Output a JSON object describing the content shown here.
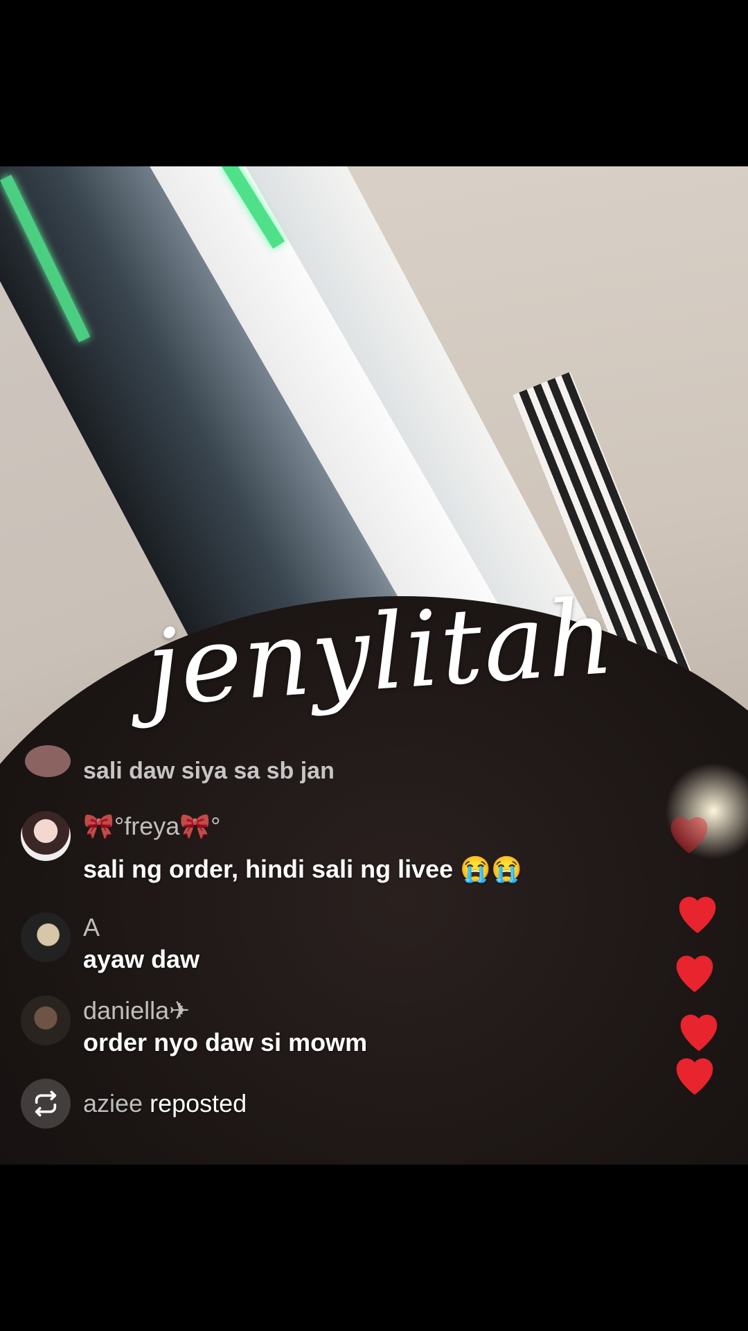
{
  "stream": {
    "watermark": "jenylitah"
  },
  "comments": [
    {
      "username": "",
      "message": "sali daw siya sa sb jan",
      "faded": true
    },
    {
      "username": "🎀°freya🎀°",
      "message": "sali ng order, hindi sali ng livee 😭😭"
    },
    {
      "username": "A",
      "message": "ayaw daw"
    },
    {
      "username": "daniella✈",
      "message": "order nyo daw si mowm"
    }
  ],
  "repost": {
    "user": "aziee",
    "action": "reposted"
  },
  "colors": {
    "heart": "#e8242e",
    "comment_text": "#ffffff",
    "username_text": "#d7d3d0"
  },
  "icons": {
    "repost": "repost-icon",
    "like": "heart-icon"
  }
}
